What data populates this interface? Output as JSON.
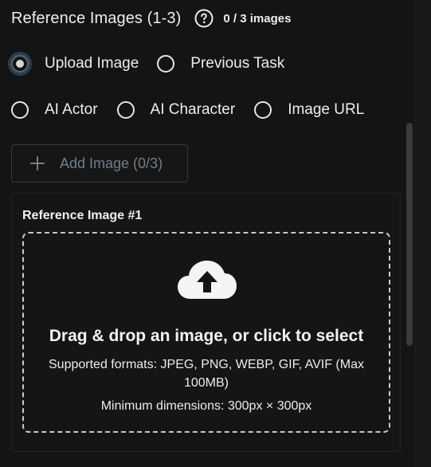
{
  "header": {
    "title": "Reference Images (1-3)",
    "help_icon": "question-circle-icon",
    "count": "0 / 3 images"
  },
  "source_options": {
    "selected": "Upload Image",
    "row1": [
      {
        "label": "Upload Image",
        "selected": true
      },
      {
        "label": "Previous Task",
        "selected": false
      }
    ],
    "row2": [
      {
        "label": "AI Actor",
        "selected": false
      },
      {
        "label": "AI Character",
        "selected": false
      },
      {
        "label": "Image URL",
        "selected": false
      }
    ]
  },
  "add_button": {
    "icon": "plus-icon",
    "label": "Add Image (0/3)"
  },
  "reference_card": {
    "title": "Reference Image #1",
    "dropzone": {
      "icon": "cloud-upload-icon",
      "title": "Drag & drop an image, or click to select",
      "formats": "Supported formats: JPEG, PNG, WEBP, GIF, AVIF (Max 100MB)",
      "dimensions": "Minimum dimensions: 300px × 300px"
    }
  },
  "colors": {
    "background": "#141414",
    "text": "#ececec",
    "accent_muted": "#6e7f8e",
    "selected_ring": "#536e87"
  }
}
